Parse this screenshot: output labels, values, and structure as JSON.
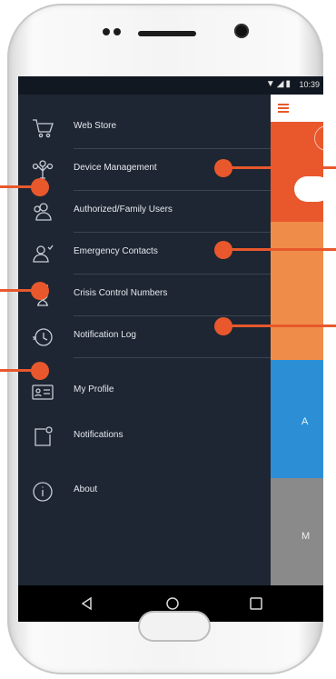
{
  "status_bar": {
    "time": "10:39",
    "icons": "▼◢▮"
  },
  "drawer": {
    "items": [
      {
        "label": "Web Store",
        "icon": "cart-icon"
      },
      {
        "label": "Device Management",
        "icon": "device-tree-icon"
      },
      {
        "label": "Authorized/Family Users",
        "icon": "users-icon"
      },
      {
        "label": "Emergency Contacts",
        "icon": "contacts-icon"
      },
      {
        "label": "Crisis Control Numbers",
        "icon": "hourglass-user-icon"
      },
      {
        "label": "Notification Log",
        "icon": "history-icon"
      },
      {
        "label": "My Profile",
        "icon": "profile-card-icon"
      },
      {
        "label": "Notifications",
        "icon": "notification-icon"
      },
      {
        "label": "About",
        "icon": "info-icon"
      }
    ]
  },
  "background_app": {
    "blue_tile_text": "A",
    "gray_tile_text": "M"
  },
  "nav_bar": {
    "back": "back-icon",
    "home": "home-icon",
    "recents": "recents-icon"
  },
  "colors": {
    "drawer_bg": "#1e2633",
    "accent_orange": "#e8582c",
    "light_orange": "#f08c4a",
    "blue": "#2c8fd6",
    "gray": "#8a8a8a"
  }
}
